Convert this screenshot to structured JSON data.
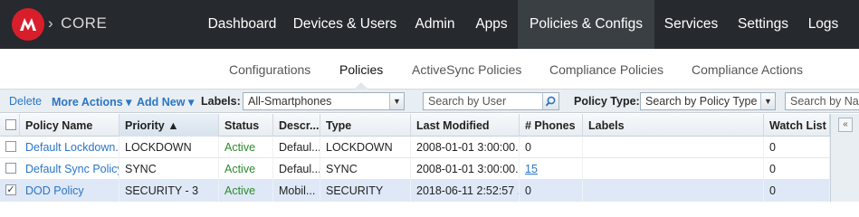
{
  "brand": {
    "name": "CORE",
    "chevron": "›",
    "logo_letter": "M",
    "color": "#d81e2b"
  },
  "nav": {
    "items": [
      "Dashboard",
      "Devices & Users",
      "Admin",
      "Apps",
      "Policies & Configs",
      "Services",
      "Settings",
      "Logs"
    ],
    "active": "Policies & Configs"
  },
  "subnav": {
    "tabs": [
      "Configurations",
      "Policies",
      "ActiveSync Policies",
      "Compliance Policies",
      "Compliance Actions"
    ],
    "active": "Policies"
  },
  "toolbar": {
    "delete": "Delete",
    "more_actions": "More Actions ▾",
    "add_new": "Add New ▾",
    "labels_label": "Labels:",
    "labels_value": "All-Smartphones",
    "search_user_placeholder": "Search by User",
    "policy_type_label": "Policy Type:",
    "policy_type_placeholder": "Search by Policy Type",
    "search_name_placeholder": "Search by Nam"
  },
  "table": {
    "headers": [
      "Policy Name",
      "Priority ▲",
      "Status",
      "Descr...",
      "Type",
      "Last Modified",
      "# Phones",
      "Labels",
      "Watch List"
    ],
    "rows": [
      {
        "checked": "",
        "name": "Default Lockdown...",
        "priority": "LOCKDOWN",
        "status": "Active",
        "descr": "Defaul...",
        "type": "LOCKDOWN",
        "modified": "2008-01-01 3:00:00...",
        "phones": "0",
        "labels": "",
        "watch": "0"
      },
      {
        "checked": "",
        "name": "Default Sync Policy",
        "priority": "SYNC",
        "status": "Active",
        "descr": "Defaul...",
        "type": "SYNC",
        "modified": "2008-01-01 3:00:00...",
        "phones": "15",
        "labels": "",
        "watch": "0"
      },
      {
        "checked": "✓",
        "name": "DOD Policy",
        "priority": "SECURITY - 3",
        "status": "Active",
        "descr": "Mobil...",
        "type": "SECURITY",
        "modified": "2018-06-11 2:52:57 ...",
        "phones": "0",
        "labels": "",
        "watch": "0"
      }
    ]
  },
  "side": {
    "collapse": "«"
  }
}
